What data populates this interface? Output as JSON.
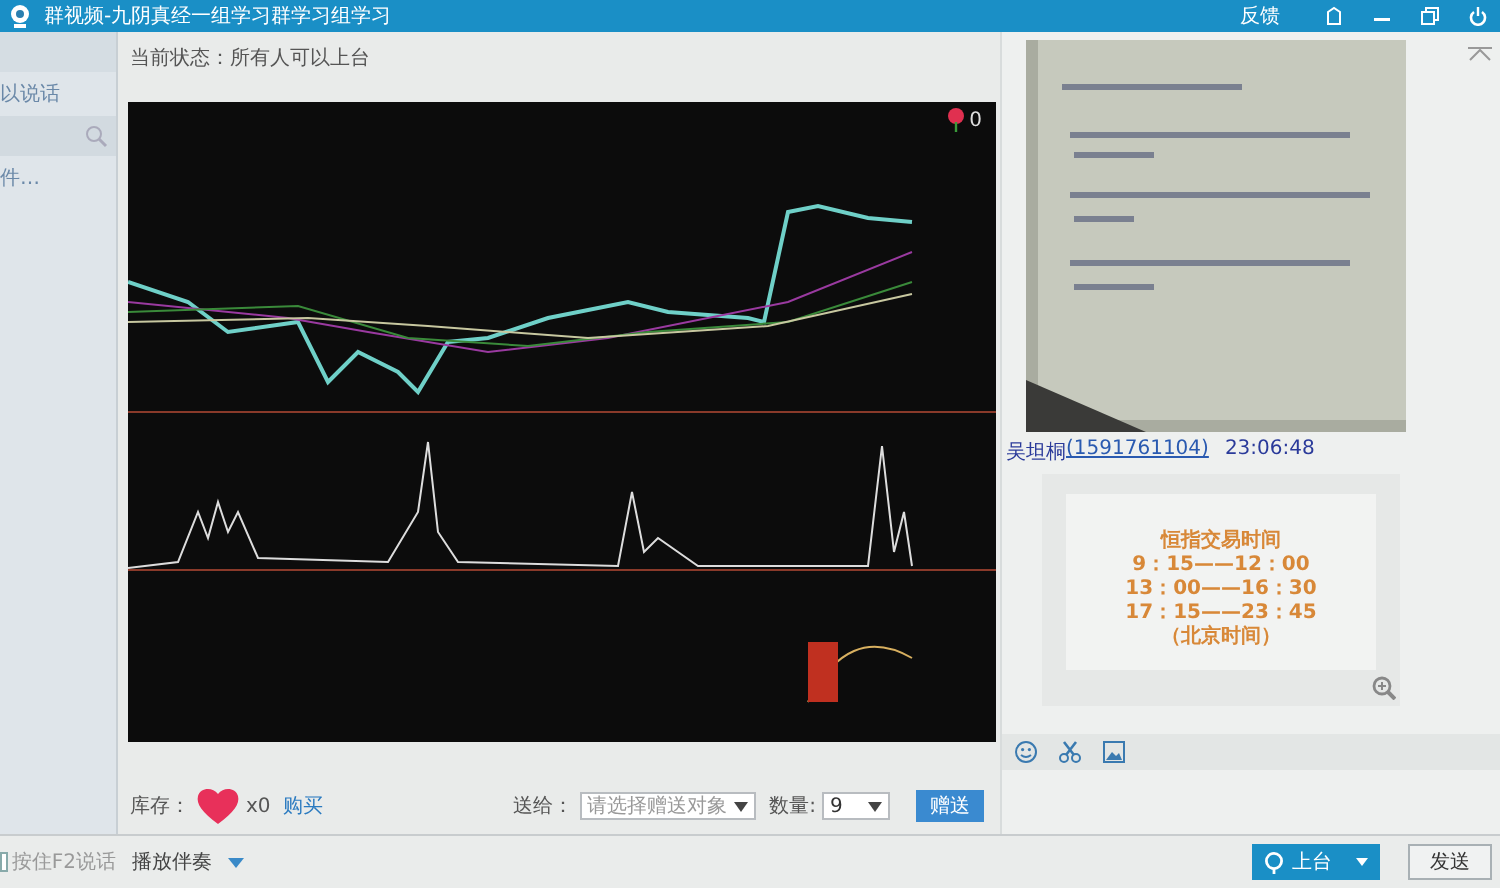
{
  "window": {
    "title": "群视频-九阴真经一组学习群学习组学习",
    "feedback": "反馈"
  },
  "sidebar": {
    "items": [
      {
        "label": "以说话"
      },
      {
        "label": "件…"
      }
    ]
  },
  "status": "当前状态：所有人可以上台",
  "video": {
    "kind": "picture",
    "flower_count": "0"
  },
  "gifts": {
    "stock_label": "库存：",
    "stock_count": "x0",
    "buy_link": "购买",
    "to_label": "送给：",
    "to_placeholder": "请选择赠送对象",
    "quantity_label": "数量:",
    "quantity": "9",
    "send_button": "赠送"
  },
  "bottom_bar": {
    "push_to_talk": {
      "label": "按住F2说话",
      "checked": false
    },
    "accompaniment": "播放伴奏",
    "stage_button": "上台"
  },
  "chat": {
    "sender": "吴坦桐",
    "sender_id": "(1591761104)",
    "time": "23:06:48",
    "card_lines": [
      "恒指交易时间",
      "9：15——12：00",
      "13：00——16：30",
      "17：15——23：45",
      "（北京时间）"
    ],
    "send_button": "发送"
  }
}
